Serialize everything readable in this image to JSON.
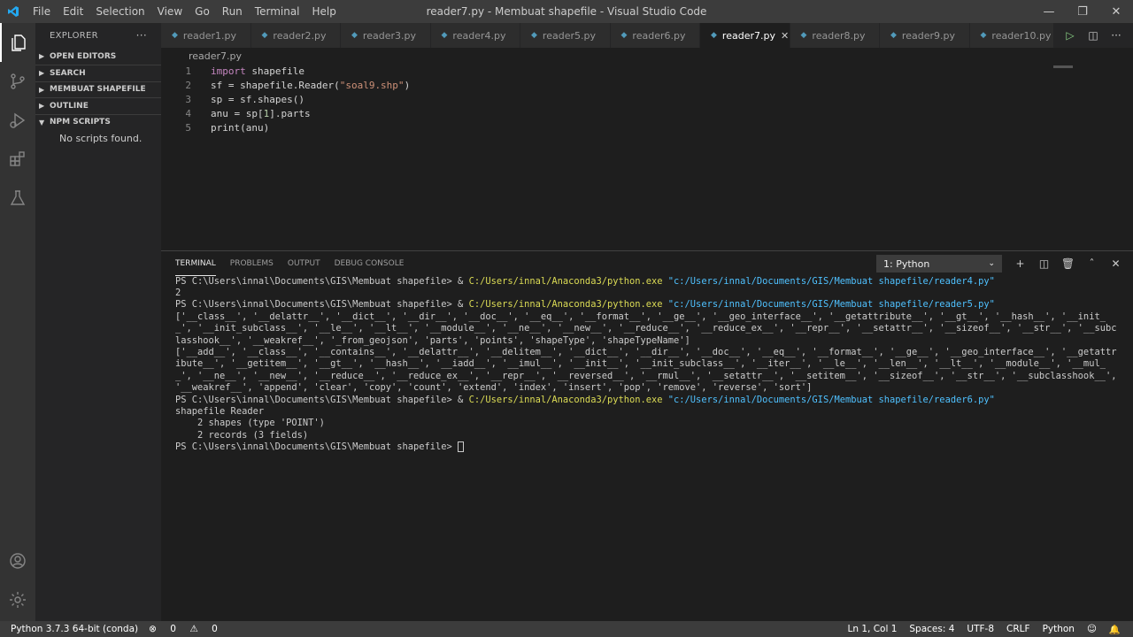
{
  "window": {
    "title": "reader7.py - Membuat shapefile - Visual Studio Code"
  },
  "menu": [
    "File",
    "Edit",
    "Selection",
    "View",
    "Go",
    "Run",
    "Terminal",
    "Help"
  ],
  "sidebar": {
    "header": "EXPLORER",
    "more": "···",
    "sections": [
      {
        "label": "OPEN EDITORS",
        "expanded": false
      },
      {
        "label": "SEARCH",
        "expanded": false
      },
      {
        "label": "MEMBUAT SHAPEFILE",
        "expanded": false
      },
      {
        "label": "OUTLINE",
        "expanded": false
      },
      {
        "label": "NPM SCRIPTS",
        "expanded": true
      }
    ],
    "npm_empty": "No scripts found."
  },
  "tabs": [
    "reader1.py",
    "reader2.py",
    "reader3.py",
    "reader4.py",
    "reader5.py",
    "reader6.py",
    "reader7.py",
    "reader8.py",
    "reader9.py",
    "reader10.py"
  ],
  "active_tab": "reader7.py",
  "breadcrumb": "reader7.py",
  "code": {
    "line_numbers": [
      "1",
      "2",
      "3",
      "4",
      "5"
    ],
    "l1_kw": "import",
    "l1_rest": " shapefile",
    "l2_a": "sf = shapefile.Reader(",
    "l2_str": "\"soal9.shp\"",
    "l2_b": ")",
    "l3": "sp = sf.shapes()",
    "l4_a": "anu = sp[",
    "l4_num": "1",
    "l4_b": "].parts",
    "l5": "print(anu)"
  },
  "panel": {
    "tabs": [
      "TERMINAL",
      "PROBLEMS",
      "OUTPUT",
      "DEBUG CONSOLE"
    ],
    "terminal_select": "1: Python",
    "prompt": "PS C:\\Users\\innal\\Documents\\GIS\\Membuat shapefile> ",
    "amp": "& ",
    "python_exe": "C:/Users/innal/Anaconda3/python.exe",
    "run4": "\"c:/Users/innal/Documents/GIS/Membuat shapefile/reader4.py\"",
    "out4": "2",
    "run5": "\"c:/Users/innal/Documents/GIS/Membuat shapefile/reader5.py\"",
    "out5a": "['__class__', '__delattr__', '__dict__', '__dir__', '__doc__', '__eq__', '__format__', '__ge__', '__geo_interface__', '__getattribute__', '__gt__', '__hash__', '__init__', '__init_subclass__', '__le__', '__lt__', '__module__', '__ne__', '__new__', '__reduce__', '__reduce_ex__', '__repr__', '__setattr__', '__sizeof__', '__str__', '__subclasshook__', '__weakref__', '_from_geojson', 'parts', 'points', 'shapeType', 'shapeTypeName']",
    "out5b": "['__add__', '__class__', '__contains__', '__delattr__', '__delitem__', '__dict__', '__dir__', '__doc__', '__eq__', '__format__', '__ge__', '__geo_interface__', '__getattribute__', '__getitem__', '__gt__', '__hash__', '__iadd__', '__imul__', '__init__', '__init_subclass__', '__iter__', '__le__', '__len__', '__lt__', '__module__', '__mul__', '__ne__', '__new__', '__reduce__', '__reduce_ex__', '__repr__', '__reversed__', '__rmul__', '__setattr__', '__setitem__', '__sizeof__', '__str__', '__subclasshook__', '__weakref__', 'append', 'clear', 'copy', 'count', 'extend', 'index', 'insert', 'pop', 'remove', 'reverse', 'sort']",
    "run6": "\"c:/Users/innal/Documents/GIS/Membuat shapefile/reader6.py\"",
    "out6a": "shapefile Reader",
    "out6b": "    2 shapes (type 'POINT')",
    "out6c": "    2 records (3 fields)"
  },
  "status": {
    "interpreter": "Python 3.7.3 64-bit (conda)",
    "errors": "0",
    "warnings": "0",
    "position": "Ln 1, Col 1",
    "spaces": "Spaces: 4",
    "encoding": "UTF-8",
    "eol": "CRLF",
    "language": "Python"
  },
  "colors": {
    "titlebar": "#3c3c3c",
    "activitybar": "#333333",
    "sidebar": "#252526",
    "editor": "#1e1e1e",
    "statusbar": "#3c3c3c",
    "accent": "#007acc"
  }
}
